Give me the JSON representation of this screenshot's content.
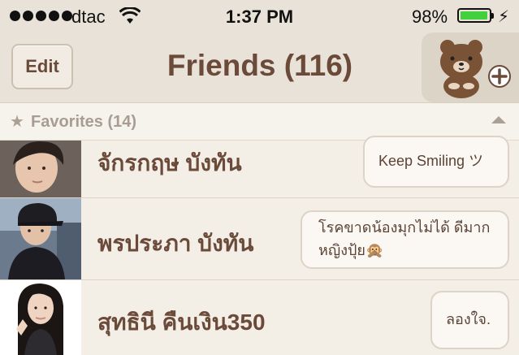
{
  "status_bar": {
    "carrier": "dtac",
    "time": "1:37 PM",
    "battery_percent": "98%",
    "battery_level": 0.98,
    "signal_bars": 5
  },
  "nav": {
    "edit_label": "Edit",
    "title": "Friends (116)",
    "add_friend_icon": "bear-add-friend-icon"
  },
  "favorites": {
    "title": "Favorites (14)",
    "icon": "star-icon",
    "collapse_icon": "chevron-up-icon"
  },
  "friends": [
    {
      "name": "จักรกฤษ บังทัน",
      "status_lines": [
        "Keep Smiling ツ"
      ]
    },
    {
      "name": "พรประภา บังทัน",
      "status_lines": [
        "โรคขาดน้องมุกไม่ได้ ดีมาก",
        "หญิงปุ้ย🙊"
      ]
    },
    {
      "name": "สุทธินี คืนเงิน350",
      "status_lines": [
        "ลองใจ."
      ]
    }
  ],
  "colors": {
    "accent_brown": "#6b4a3a",
    "battery_green": "#42d13d",
    "background": "#f3eee6"
  }
}
